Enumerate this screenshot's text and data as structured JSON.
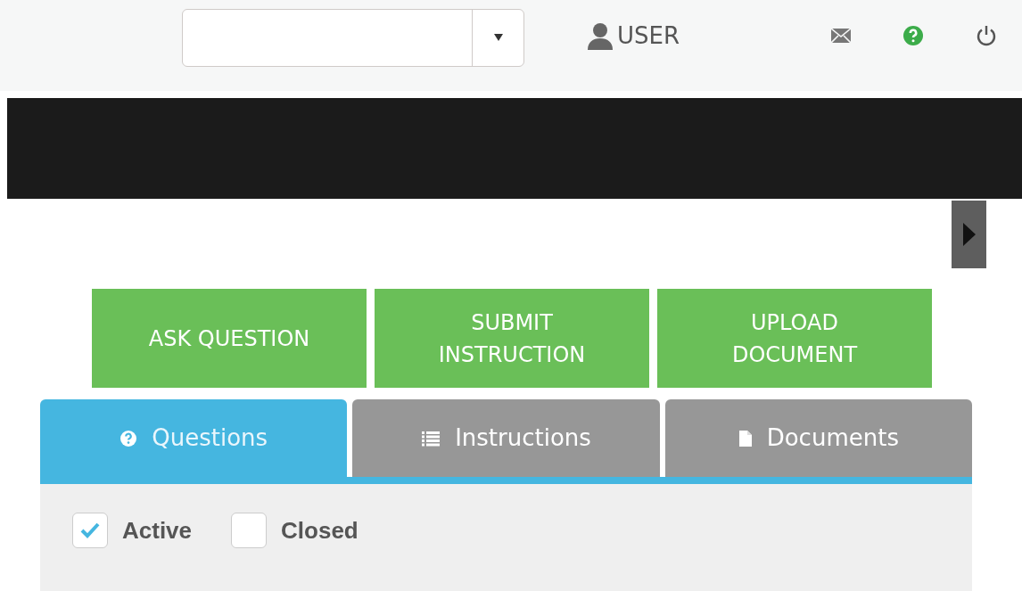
{
  "header": {
    "user_label": "USER"
  },
  "actions": [
    {
      "label": "ASK QUESTION"
    },
    {
      "label": "SUBMIT INSTRUCTION"
    },
    {
      "label": "UPLOAD DOCUMENT"
    }
  ],
  "tabs": [
    {
      "label": "Questions",
      "selected": true
    },
    {
      "label": "Instructions",
      "selected": false
    },
    {
      "label": "Documents",
      "selected": false
    }
  ],
  "filters": [
    {
      "label": "Active",
      "checked": true
    },
    {
      "label": "Closed",
      "checked": false
    }
  ]
}
